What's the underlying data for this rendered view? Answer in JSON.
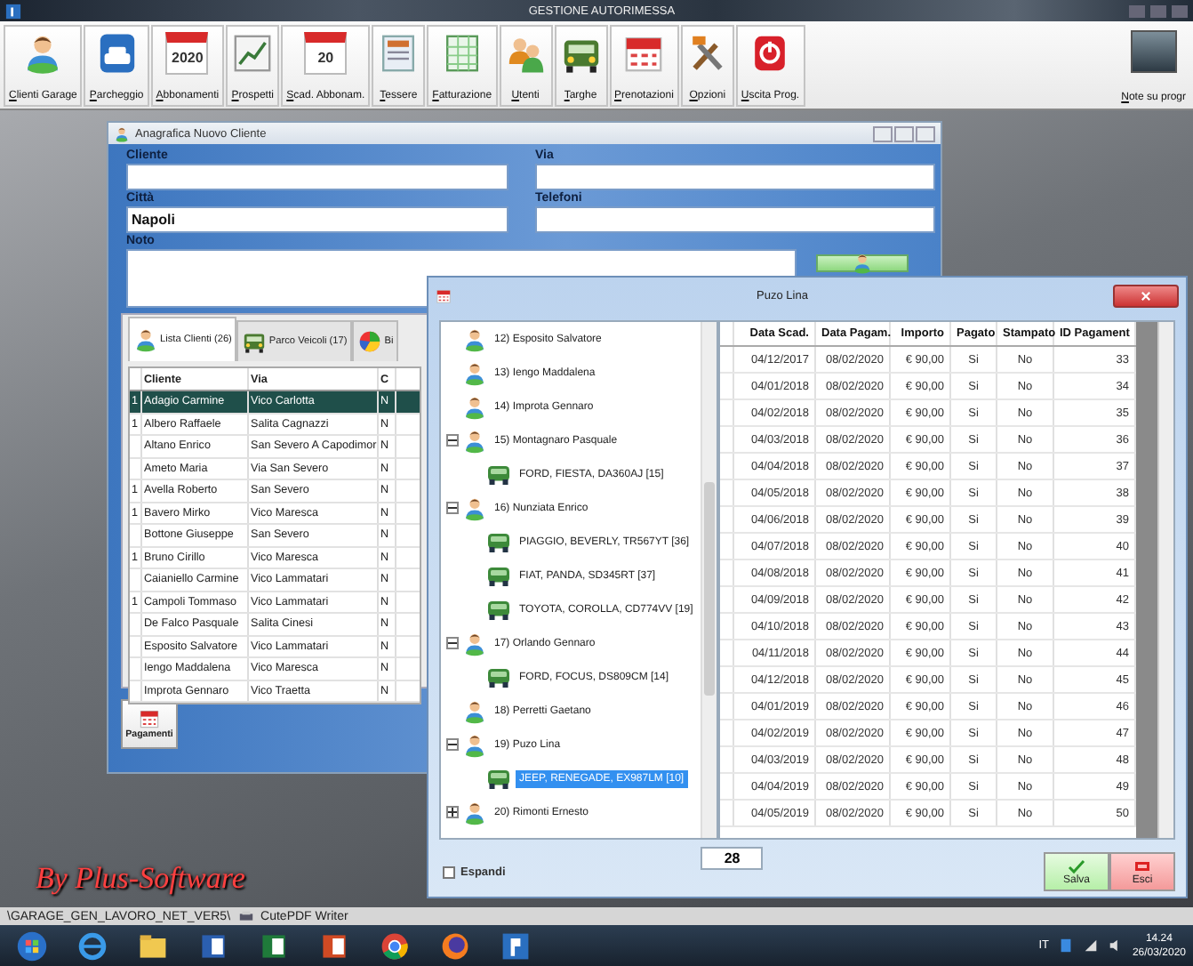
{
  "window": {
    "title": "GESTIONE AUTORIMESSA"
  },
  "toolbar": [
    {
      "label": "Clienti Garage",
      "kind": "person"
    },
    {
      "label": "Parcheggio",
      "kind": "parking"
    },
    {
      "label": "Abbonamenti",
      "kind": "calendar",
      "badge": "2020"
    },
    {
      "label": "Prospetti",
      "kind": "chart"
    },
    {
      "label": "Scad. Abbonam.",
      "kind": "calendar",
      "badge": "20"
    },
    {
      "label": "Tessere",
      "kind": "card"
    },
    {
      "label": "Fatturazione",
      "kind": "sheet"
    },
    {
      "label": "Utenti",
      "kind": "people"
    },
    {
      "label": "Targhe",
      "kind": "car"
    },
    {
      "label": "Prenotazioni",
      "kind": "planner"
    },
    {
      "label": "Opzioni",
      "kind": "tools"
    },
    {
      "label": "Uscita Prog.",
      "kind": "power"
    }
  ],
  "toolbar_right": {
    "label": "Note su progr"
  },
  "brand": "By Plus-Software",
  "client_window": {
    "title": "Anagrafica Nuovo Cliente",
    "fields": [
      {
        "label": "Cliente"
      },
      {
        "label": "Via"
      },
      {
        "label": "Città",
        "value": "Napoli"
      },
      {
        "label": "Telefoni"
      }
    ],
    "note": {
      "label": "Noto"
    },
    "tabs": [
      {
        "label": "Lista Clienti (26)",
        "kind": "person",
        "selected": true
      },
      {
        "label": "Parco Veicoli (17)",
        "kind": "car",
        "selected": false
      },
      {
        "label": "Bi",
        "kind": "pie",
        "selected": false
      }
    ],
    "grid": {
      "columns": [
        "Cliente",
        "Via",
        "C"
      ],
      "rows": [
        {
          "marker": "1",
          "cliente": "Adagio Carmine",
          "via": "Vico Carlotta",
          "column_3": "N",
          "selected": true
        },
        {
          "marker": "1",
          "cliente": "Albero Raffaele",
          "via": "Salita Cagnazzi",
          "column_3": "N",
          "selected": false
        },
        {
          "cliente": "Altano Enrico",
          "via": "San Severo A Capodimor",
          "column_3": "N",
          "selected": false
        },
        {
          "cliente": "Ameto Maria",
          "via": "Via San Severo",
          "column_3": "N",
          "selected": false
        },
        {
          "marker": "1",
          "cliente": "Avella Roberto",
          "via": "San Severo",
          "column_3": "N",
          "selected": false
        },
        {
          "marker": "1",
          "cliente": "Bavero Mirko",
          "via": "Vico Maresca",
          "column_3": "N",
          "selected": false
        },
        {
          "cliente": "Bottone Giuseppe",
          "via": "San Severo",
          "column_3": "N",
          "selected": false
        },
        {
          "marker": "1",
          "cliente": "Bruno Cirillo",
          "via": "Vico Maresca",
          "column_3": "N",
          "selected": false
        },
        {
          "cliente": "Caianiello Carmine",
          "via": "Vico Lammatari",
          "column_3": "N",
          "selected": false
        },
        {
          "marker": "1",
          "cliente": "Campoli Tommaso",
          "via": "Vico Lammatari",
          "column_3": "N",
          "selected": false
        },
        {
          "cliente": "De Falco Pasquale",
          "via": "Salita Cinesi",
          "column_3": "N",
          "selected": false
        },
        {
          "cliente": "Esposito Salvatore",
          "via": "Vico Lammatari",
          "column_3": "N",
          "selected": false
        },
        {
          "cliente": "Iengo Maddalena",
          "via": "Vico Maresca",
          "column_3": "N",
          "selected": false
        },
        {
          "cliente": "Improta Gennaro",
          "via": "Vico Traetta",
          "column_3": "N",
          "selected": false
        }
      ]
    },
    "payments_button": {
      "label": "Pagamenti"
    }
  },
  "pay_window": {
    "title": "Puzo Lina",
    "tree": [
      {
        "label": "12) Esposito Salvatore",
        "kind": "person",
        "selected": false
      },
      {
        "label": "13) Iengo Maddalena",
        "kind": "person",
        "selected": false
      },
      {
        "label": "14) Improta Gennaro",
        "kind": "person",
        "selected": false
      },
      {
        "label": "15) Montagnaro Pasquale",
        "kind": "person",
        "selected": false,
        "expanded": true,
        "children": [
          {
            "label": "FORD, FIESTA, DA360AJ  [15]",
            "kind": "vehicle",
            "selected": false
          }
        ]
      },
      {
        "label": "16) Nunziata Enrico",
        "kind": "person",
        "selected": false,
        "expanded": true,
        "children": [
          {
            "label": "PIAGGIO, BEVERLY, TR567YT  [36]",
            "kind": "vehicle",
            "selected": false
          },
          {
            "label": "FIAT, PANDA, SD345RT  [37]",
            "kind": "vehicle",
            "selected": false
          },
          {
            "label": "TOYOTA, COROLLA, CD774VV  [19]",
            "kind": "vehicle",
            "selected": false
          }
        ]
      },
      {
        "label": "17) Orlando Gennaro",
        "kind": "person",
        "selected": false,
        "expanded": true,
        "children": [
          {
            "label": "FORD, FOCUS, DS809CM  [14]",
            "kind": "vehicle",
            "selected": false
          }
        ]
      },
      {
        "label": "18) Perretti Gaetano",
        "kind": "person",
        "selected": false
      },
      {
        "label": "19) Puzo Lina",
        "kind": "person",
        "selected": false,
        "expanded": true,
        "children": [
          {
            "label": "JEEP, RENEGADE, EX987LM  [10]",
            "kind": "vehicle",
            "selected": true
          }
        ]
      },
      {
        "label": "20) Rimonti Ernesto",
        "kind": "person",
        "selected": false,
        "expanded": false
      }
    ],
    "table": {
      "columns": [
        "Data Scad.",
        "Data Pagam.",
        "Importo",
        "Pagato",
        "Stampato",
        "ID Pagament"
      ],
      "rows": [
        [
          "04/12/2017",
          "08/02/2020",
          "€ 90,00",
          "Si",
          "No",
          "33"
        ],
        [
          "04/01/2018",
          "08/02/2020",
          "€ 90,00",
          "Si",
          "No",
          "34"
        ],
        [
          "04/02/2018",
          "08/02/2020",
          "€ 90,00",
          "Si",
          "No",
          "35"
        ],
        [
          "04/03/2018",
          "08/02/2020",
          "€ 90,00",
          "Si",
          "No",
          "36"
        ],
        [
          "04/04/2018",
          "08/02/2020",
          "€ 90,00",
          "Si",
          "No",
          "37"
        ],
        [
          "04/05/2018",
          "08/02/2020",
          "€ 90,00",
          "Si",
          "No",
          "38"
        ],
        [
          "04/06/2018",
          "08/02/2020",
          "€ 90,00",
          "Si",
          "No",
          "39"
        ],
        [
          "04/07/2018",
          "08/02/2020",
          "€ 90,00",
          "Si",
          "No",
          "40"
        ],
        [
          "04/08/2018",
          "08/02/2020",
          "€ 90,00",
          "Si",
          "No",
          "41"
        ],
        [
          "04/09/2018",
          "08/02/2020",
          "€ 90,00",
          "Si",
          "No",
          "42"
        ],
        [
          "04/10/2018",
          "08/02/2020",
          "€ 90,00",
          "Si",
          "No",
          "43"
        ],
        [
          "04/11/2018",
          "08/02/2020",
          "€ 90,00",
          "Si",
          "No",
          "44"
        ],
        [
          "04/12/2018",
          "08/02/2020",
          "€ 90,00",
          "Si",
          "No",
          "45"
        ],
        [
          "04/01/2019",
          "08/02/2020",
          "€ 90,00",
          "Si",
          "No",
          "46"
        ],
        [
          "04/02/2019",
          "08/02/2020",
          "€ 90,00",
          "Si",
          "No",
          "47"
        ],
        [
          "04/03/2019",
          "08/02/2020",
          "€ 90,00",
          "Si",
          "No",
          "48"
        ],
        [
          "04/04/2019",
          "08/02/2020",
          "€ 90,00",
          "Si",
          "No",
          "49"
        ],
        [
          "04/05/2019",
          "08/02/2020",
          "€ 90,00",
          "Si",
          "No",
          "50"
        ]
      ]
    },
    "expand": {
      "label": "Espandi",
      "checked": false
    },
    "count": "28",
    "buttons": [
      {
        "label": "Salva",
        "kind": "save"
      },
      {
        "label": "Esci",
        "kind": "exit"
      }
    ]
  },
  "status_strip": [
    "\\GARAGE_GEN_LAVORO_NET_VER5\\",
    "CutePDF Writer"
  ],
  "taskbar": {
    "language": "IT",
    "time": "14.24",
    "date": "26/03/2020"
  }
}
